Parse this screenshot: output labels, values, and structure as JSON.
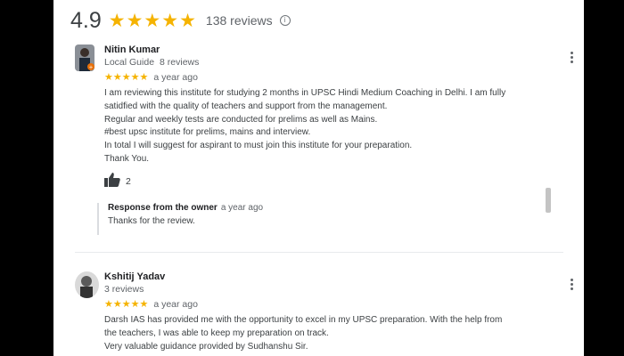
{
  "summary": {
    "rating": "4.9",
    "stars": "★★★★★",
    "review_count": "138 reviews",
    "info_icon": "info-icon"
  },
  "reviews": [
    {
      "name": "Nitin Kumar",
      "badge": "Local Guide",
      "review_count": "8 reviews",
      "stars": "★★★★★",
      "time": "a year ago",
      "lines": [
        "I am reviewing this institute for studying 2 months in UPSC Hindi Medium Coaching in Delhi. I am fully",
        "satidfied with the quality of teachers and support from the management.",
        "Regular and weekly tests are conducted for prelims as well as Mains.",
        "#best upsc institute for prelims, mains and interview.",
        "In total I will suggest for aspirant to must join this institute for your preparation.",
        "Thank You."
      ],
      "likes": "2",
      "owner_response": {
        "label": "Response from the owner",
        "time": "a year ago",
        "text": "Thanks for the review."
      }
    },
    {
      "name": "Kshitij Yadav",
      "review_count": "3 reviews",
      "stars": "★★★★★",
      "time": "a year ago",
      "lines": [
        "Darsh IAS has provided me with the opportunity to excel in my UPSC preparation. With the help from",
        "the teachers, I was able to keep my preparation on track.",
        "Very valuable guidance provided by Sudhanshu Sir."
      ]
    }
  ]
}
